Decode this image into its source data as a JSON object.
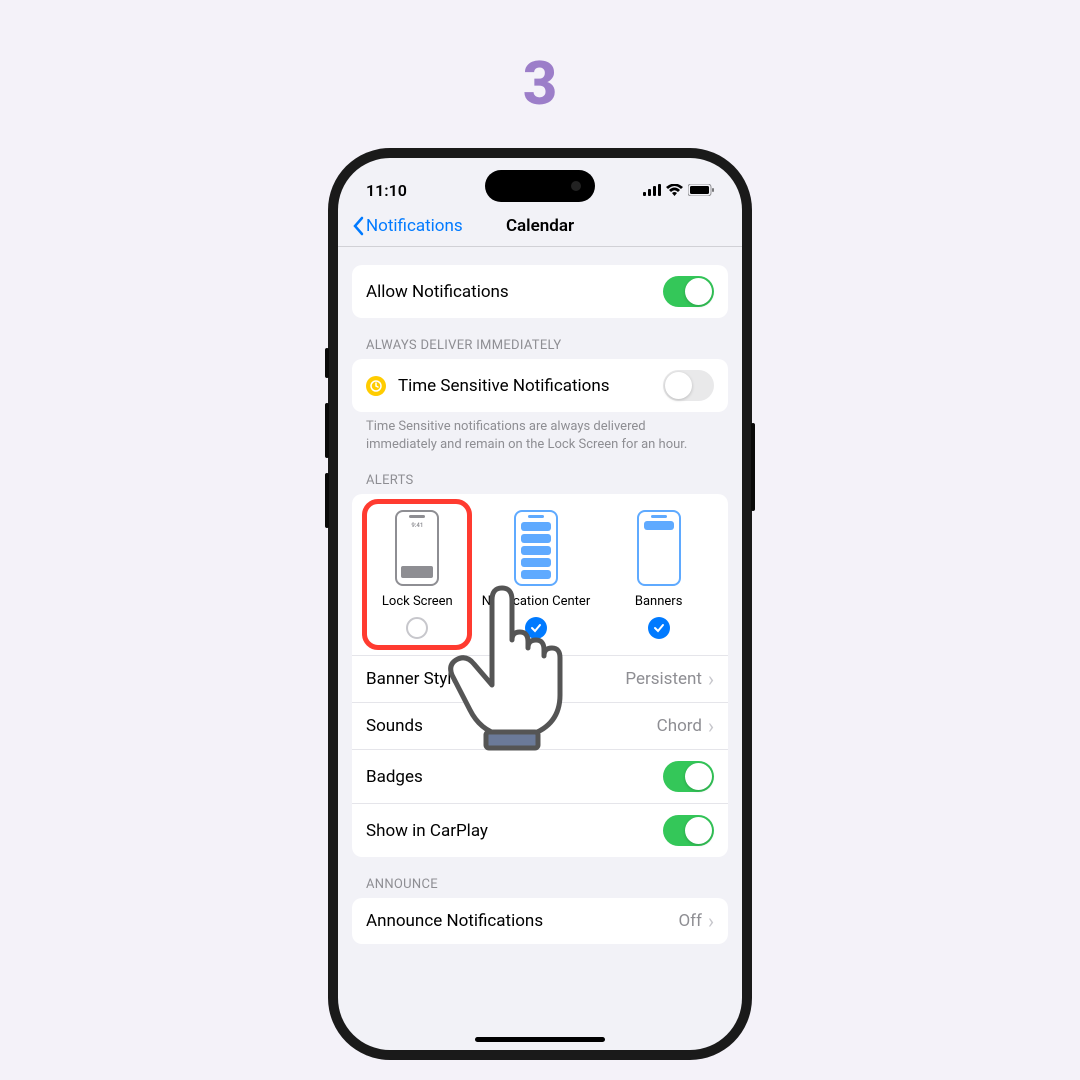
{
  "step": "3",
  "statusbar": {
    "time": "11:10"
  },
  "nav": {
    "back": "Notifications",
    "title": "Calendar"
  },
  "allow": {
    "label": "Allow Notifications",
    "on": true
  },
  "deliver": {
    "header": "ALWAYS DELIVER IMMEDIATELY",
    "label": "Time Sensitive Notifications",
    "on": false,
    "footer": "Time Sensitive notifications are always delivered immediately and remain on the Lock Screen for an hour."
  },
  "alerts": {
    "header": "ALERTS",
    "lockTime": "9:41",
    "items": [
      {
        "label": "Lock Screen",
        "checked": false,
        "highlight": true
      },
      {
        "label": "Notification Center",
        "checked": true
      },
      {
        "label": "Banners",
        "checked": true
      }
    ]
  },
  "rows": [
    {
      "label": "Banner Style",
      "value": "Persistent",
      "type": "link"
    },
    {
      "label": "Sounds",
      "value": "Chord",
      "type": "link"
    },
    {
      "label": "Badges",
      "type": "toggle",
      "on": true
    },
    {
      "label": "Show in CarPlay",
      "type": "toggle",
      "on": true
    }
  ],
  "announce": {
    "header": "ANNOUNCE",
    "label": "Announce Notifications",
    "value": "Off"
  }
}
